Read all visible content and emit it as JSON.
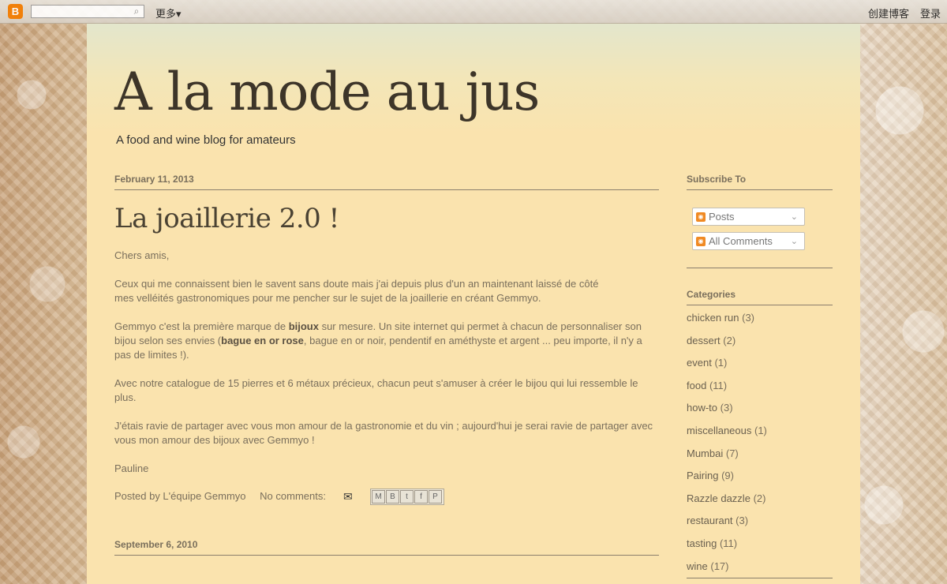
{
  "navbar": {
    "search_placeholder": "",
    "more_label": "更多▾",
    "create_blog": "创建博客",
    "login": "登录"
  },
  "blog": {
    "title": "A la mode au jus",
    "description": "A food and wine blog for amateurs"
  },
  "posts": [
    {
      "date": "February 11, 2013",
      "title": "La joaillerie 2.0 !",
      "greeting": "Chers amis,",
      "p1": "Ceux qui me connaissent bien le savent sans doute mais j'ai depuis plus d'un an maintenant laissé de côté mes velléités gastronomiques pour me pencher sur le sujet de la joaillerie en créant Gemmyo.",
      "p2_a": "Gemmyo c'est la première marque de ",
      "p2_b": "bijoux",
      "p2_c": " sur mesure. Un site internet qui permet à chacun de personnaliser son bijou selon ses envies (",
      "p2_d": "bague en or rose",
      "p2_e": ", bague en or noir, pendentif en améthyste et argent ... peu importe, il n'y a pas de limites !).",
      "p3": "Avec notre catalogue de 15 pierres et 6 métaux précieux, chacun peut s'amuser à créer le bijou qui lui ressemble le plus.",
      "p4": "J'étais ravie de partager avec vous mon amour de la gastronomie et du vin ; aujourd'hui je serai ravie de partager avec vous mon amour des bijoux avec Gemmyo !",
      "signature": "Pauline",
      "posted_by": "Posted by L'équipe Gemmyo",
      "comments": "No comments:"
    },
    {
      "date": "September 6, 2010"
    }
  ],
  "sidebar": {
    "subscribe_heading": "Subscribe To",
    "posts_label": "Posts",
    "comments_label": "All Comments",
    "categories_heading": "Categories",
    "categories": [
      {
        "name": "chicken run",
        "count": "(3)"
      },
      {
        "name": "dessert",
        "count": "(2)"
      },
      {
        "name": "event",
        "count": "(1)"
      },
      {
        "name": "food",
        "count": "(11)"
      },
      {
        "name": "how-to",
        "count": "(3)"
      },
      {
        "name": "miscellaneous",
        "count": "(1)"
      },
      {
        "name": "Mumbai",
        "count": "(7)"
      },
      {
        "name": "Pairing",
        "count": "(9)"
      },
      {
        "name": "Razzle dazzle",
        "count": "(2)"
      },
      {
        "name": "restaurant",
        "count": "(3)"
      },
      {
        "name": "tasting",
        "count": "(11)"
      },
      {
        "name": "wine",
        "count": "(17)"
      }
    ]
  },
  "share_buttons": [
    "M",
    "B",
    "t",
    "f",
    "P"
  ]
}
